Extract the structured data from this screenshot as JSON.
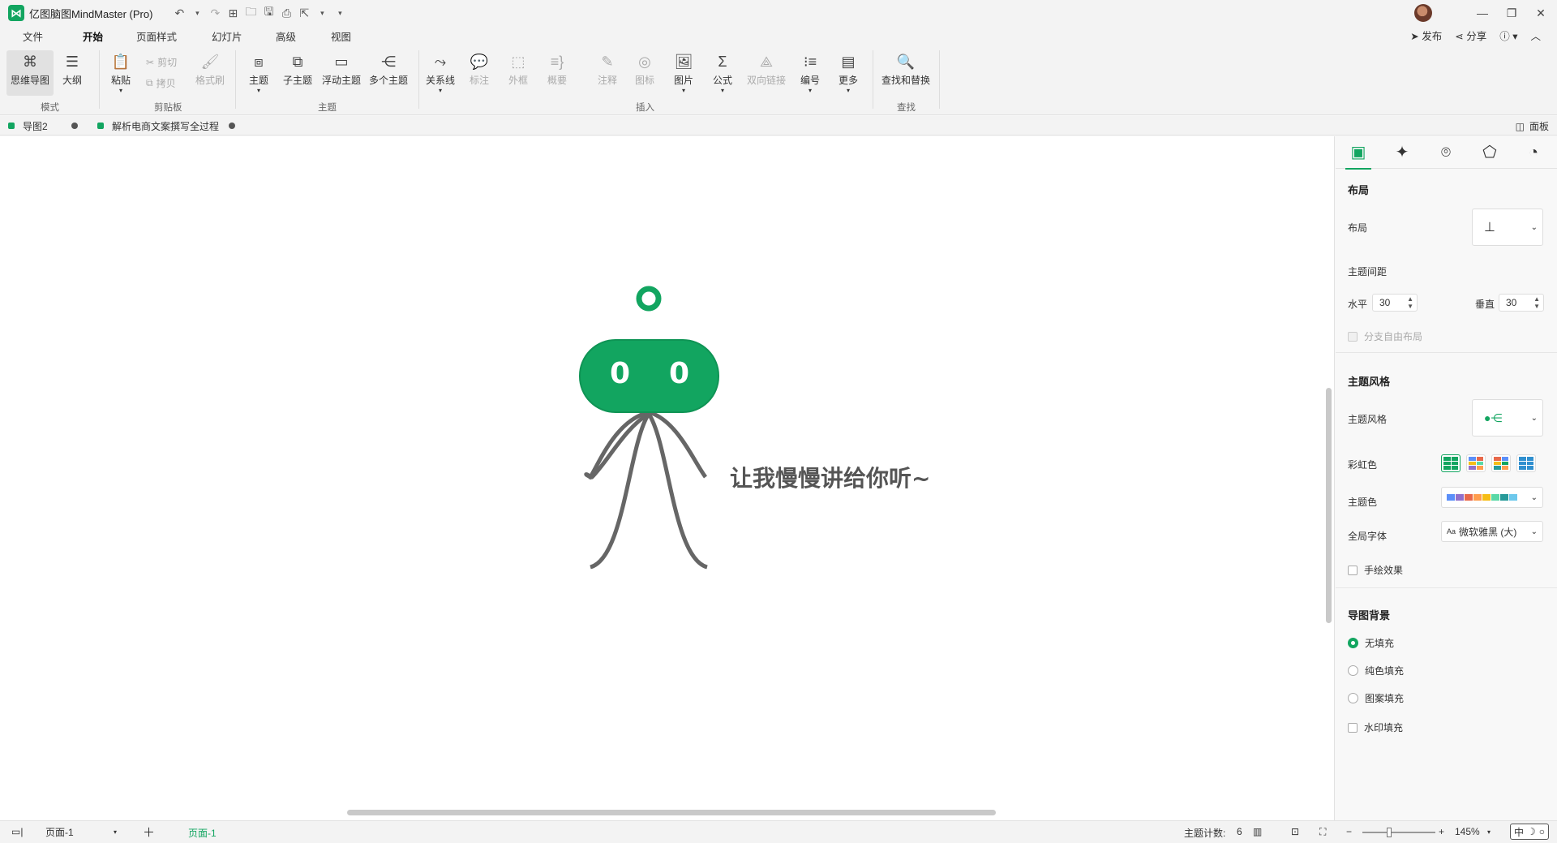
{
  "app": {
    "title": "亿图脑图MindMaster (Pro)"
  },
  "menu": {
    "tabs": [
      "文件",
      "开始",
      "页面样式",
      "幻灯片",
      "高级",
      "视图"
    ],
    "active_tab": "开始",
    "publish": "发布",
    "share": "分享"
  },
  "ribbon": {
    "mode": {
      "mindmap": "思维导图",
      "outline": "大纲",
      "group": "模式"
    },
    "clipboard": {
      "paste": "粘贴",
      "cut": "剪切",
      "copy": "拷贝",
      "format_painter": "格式刷",
      "group": "剪贴板"
    },
    "topic": {
      "topic": "主题",
      "subtopic": "子主题",
      "floating": "浮动主题",
      "multiple": "多个主题",
      "group": "主题"
    },
    "insert": {
      "relationship": "关系线",
      "callout": "标注",
      "boundary": "外框",
      "summary": "概要",
      "note": "注释",
      "icon": "图标",
      "image": "图片",
      "formula": "公式",
      "bilink": "双向链接",
      "numbering": "编号",
      "more": "更多",
      "group": "插入"
    },
    "find": {
      "find_replace": "查找和替换",
      "group": "查找"
    }
  },
  "doc_tabs": [
    {
      "label": "导图2"
    },
    {
      "label": "解析电商文案撰写全过程"
    }
  ],
  "panel_toggle": "面板",
  "canvas": {
    "node_text": "让我慢慢讲给你听~",
    "robot_eyes": [
      "0",
      "0"
    ]
  },
  "right_panel": {
    "layout_section": "布局",
    "layout_label": "布局",
    "spacing_label": "主题间距",
    "horizontal_label": "水平",
    "horizontal_value": "30",
    "vertical_label": "垂直",
    "vertical_value": "30",
    "free_layout_label": "分支自由布局",
    "style_section": "主题风格",
    "style_label": "主题风格",
    "rainbow_label": "彩虹色",
    "theme_color_label": "主题色",
    "theme_colors": [
      "#5b8ff9",
      "#9270ca",
      "#e8684a",
      "#ff9d4d",
      "#f6bd16",
      "#5ad8a6",
      "#269a99",
      "#6dc8ec"
    ],
    "font_label": "全局字体",
    "font_value": "微软雅黑 (大)",
    "handdrawn_label": "手绘效果",
    "bg_section": "导图背景",
    "bg_options": [
      "无填充",
      "纯色填充",
      "图案填充",
      "水印填充"
    ],
    "bg_selected": "无填充"
  },
  "status": {
    "page_select": "页面-1",
    "page_tab": "页面-1",
    "topic_count_label": "主题计数:",
    "topic_count": "6",
    "zoom": "145%",
    "ime": "中"
  },
  "colors": {
    "accent": "#12a560",
    "node_fill": "#12a560",
    "branch": "#666666"
  }
}
